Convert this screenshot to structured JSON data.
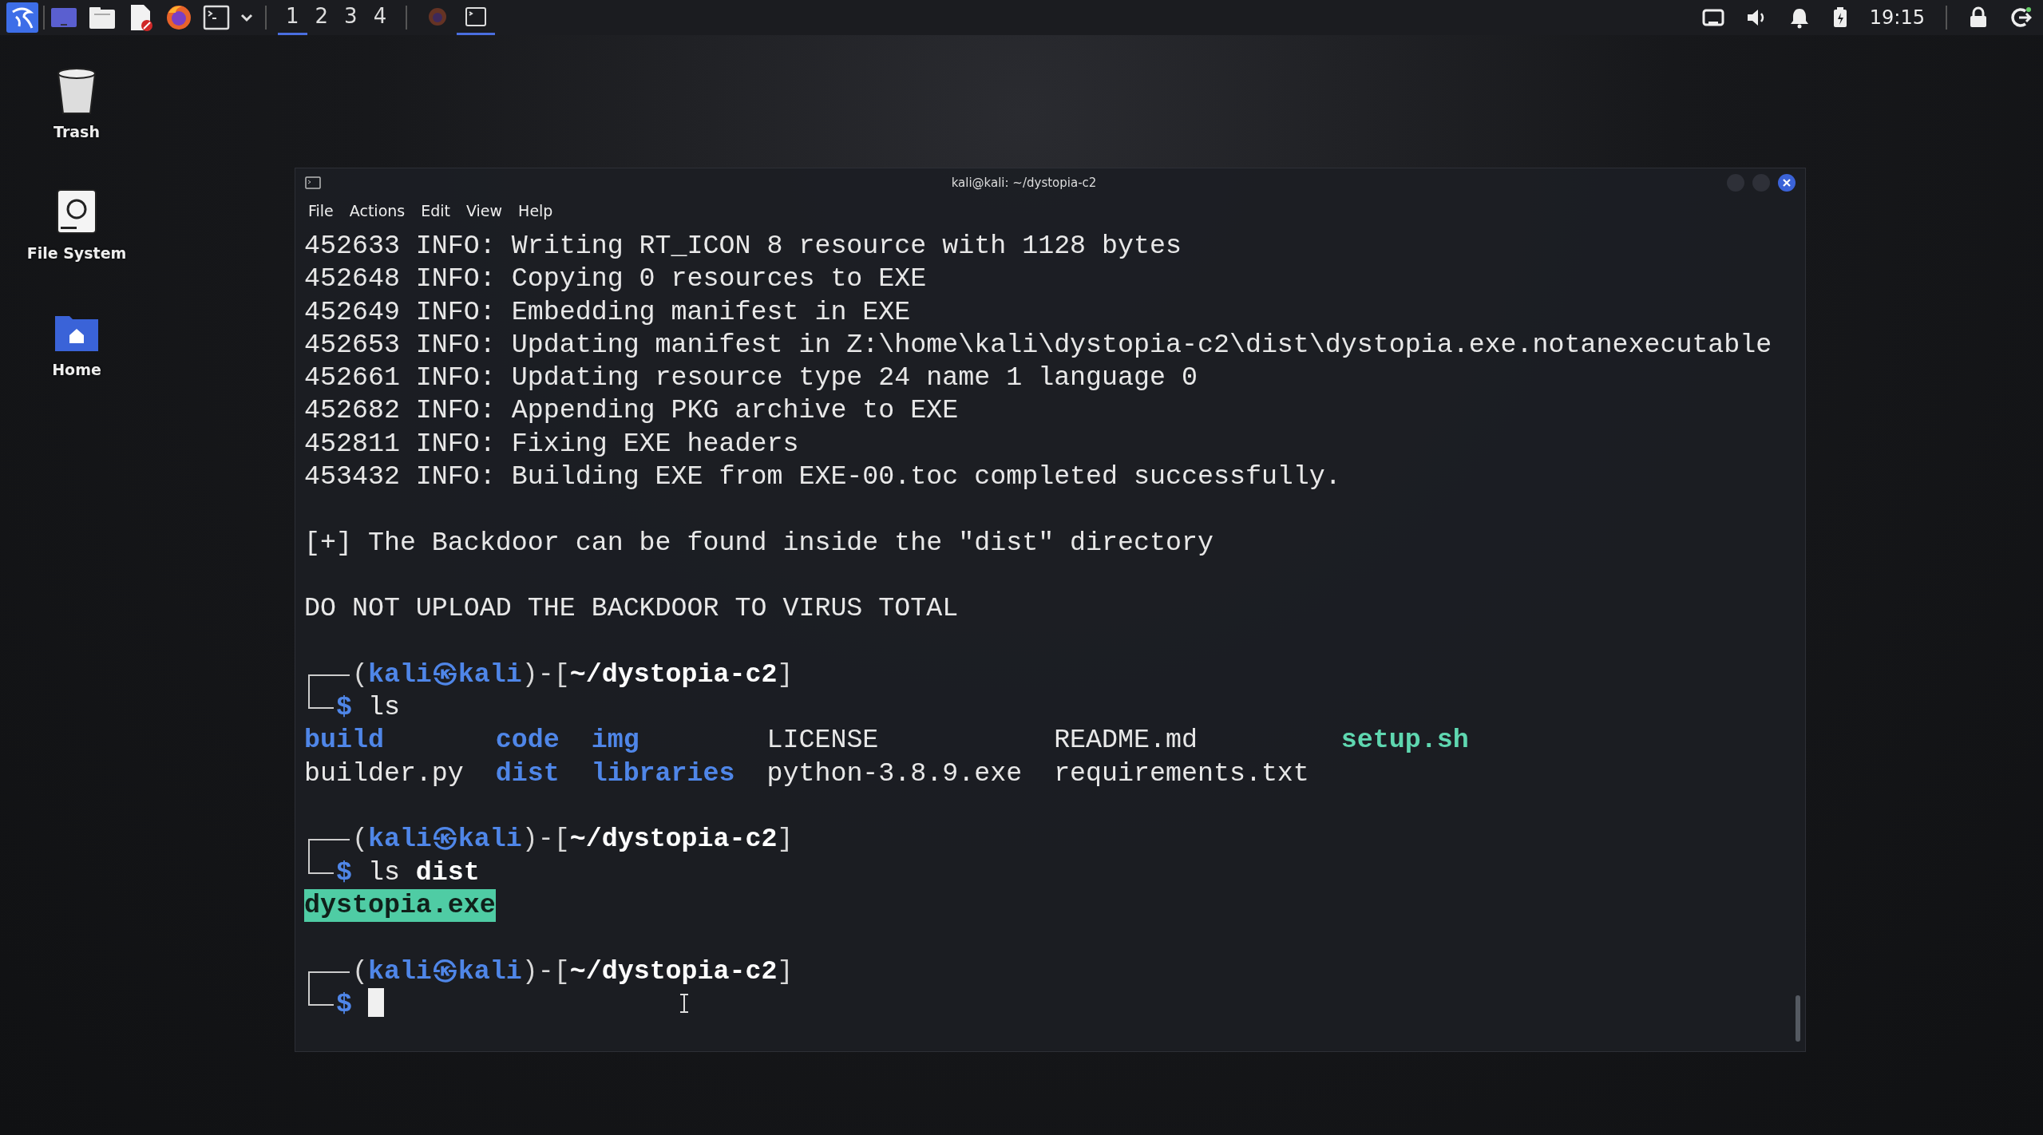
{
  "taskbar": {
    "workspaces": [
      {
        "label": "1",
        "selected": true
      },
      {
        "label": "2",
        "selected": false
      },
      {
        "label": "3",
        "selected": false
      },
      {
        "label": "4",
        "selected": false
      }
    ],
    "tasks": [
      {
        "kind": "browser",
        "selected": false
      },
      {
        "kind": "terminal",
        "selected": true
      }
    ],
    "clock": "19:15"
  },
  "desktop_icons": [
    {
      "kind": "trash",
      "label": "Trash"
    },
    {
      "kind": "drive",
      "label": "File System"
    },
    {
      "kind": "home",
      "label": "Home"
    }
  ],
  "terminal": {
    "title": "kali@kali: ~/dystopia-c2",
    "menu": [
      "File",
      "Actions",
      "Edit",
      "View",
      "Help"
    ],
    "lines": [
      {
        "kind": "log",
        "text": "452633 INFO: Writing RT_ICON 8 resource with 1128 bytes"
      },
      {
        "kind": "log",
        "text": "452648 INFO: Copying 0 resources to EXE"
      },
      {
        "kind": "log",
        "text": "452649 INFO: Embedding manifest in EXE"
      },
      {
        "kind": "log",
        "text": "452653 INFO: Updating manifest in Z:\\home\\kali\\dystopia-c2\\dist\\dystopia.exe.notanexecutable"
      },
      {
        "kind": "log",
        "text": "452661 INFO: Updating resource type 24 name 1 language 0"
      },
      {
        "kind": "log",
        "text": "452682 INFO: Appending PKG archive to EXE"
      },
      {
        "kind": "log",
        "text": "452811 INFO: Fixing EXE headers"
      },
      {
        "kind": "log",
        "text": "453432 INFO: Building EXE from EXE-00.toc completed successfully."
      },
      {
        "kind": "blank"
      },
      {
        "kind": "log",
        "text": "[+] The Backdoor can be found inside the \"dist\" directory"
      },
      {
        "kind": "blank"
      },
      {
        "kind": "log",
        "text": "DO NOT UPLOAD THE BACKDOOR TO VIRUS TOTAL"
      },
      {
        "kind": "blank"
      },
      {
        "kind": "prompt",
        "segments": [
          "(",
          "kali㉿kali",
          ")-[",
          "~/dystopia-c2",
          "]"
        ]
      },
      {
        "kind": "command",
        "symbol": "$",
        "command": "ls",
        "cursor": false
      },
      {
        "kind": "listing",
        "entries": [
          {
            "kind": "dir",
            "name": "build"
          },
          {
            "kind": "dir",
            "name": "code"
          },
          {
            "kind": "dir",
            "name": "img"
          },
          {
            "kind": "file",
            "name": "LICENSE"
          },
          {
            "kind": "file",
            "name": "README.md"
          },
          {
            "kind": "exec",
            "name": "setup.sh"
          }
        ]
      },
      {
        "kind": "listing",
        "entries": [
          {
            "kind": "file",
            "name": "builder.py"
          },
          {
            "kind": "dir",
            "name": "dist"
          },
          {
            "kind": "dir",
            "name": "libraries"
          },
          {
            "kind": "file",
            "name": "python-3.8.9.exe"
          },
          {
            "kind": "file",
            "name": "requirements.txt"
          }
        ]
      },
      {
        "kind": "blank"
      },
      {
        "kind": "prompt",
        "segments": [
          "(",
          "kali㉿kali",
          ")-[",
          "~/dystopia-c2",
          "]"
        ]
      },
      {
        "kind": "command",
        "symbol": "$",
        "command": "ls",
        "argument": "dist",
        "cursor": false
      },
      {
        "kind": "listing",
        "entries": [
          {
            "kind": "highlight",
            "name": "dystopia.exe"
          }
        ]
      },
      {
        "kind": "blank"
      },
      {
        "kind": "prompt",
        "segments": [
          "(",
          "kali㉿kali",
          ")-[",
          "~/dystopia-c2",
          "]"
        ]
      },
      {
        "kind": "command",
        "symbol": "$",
        "cursor": true
      }
    ]
  }
}
